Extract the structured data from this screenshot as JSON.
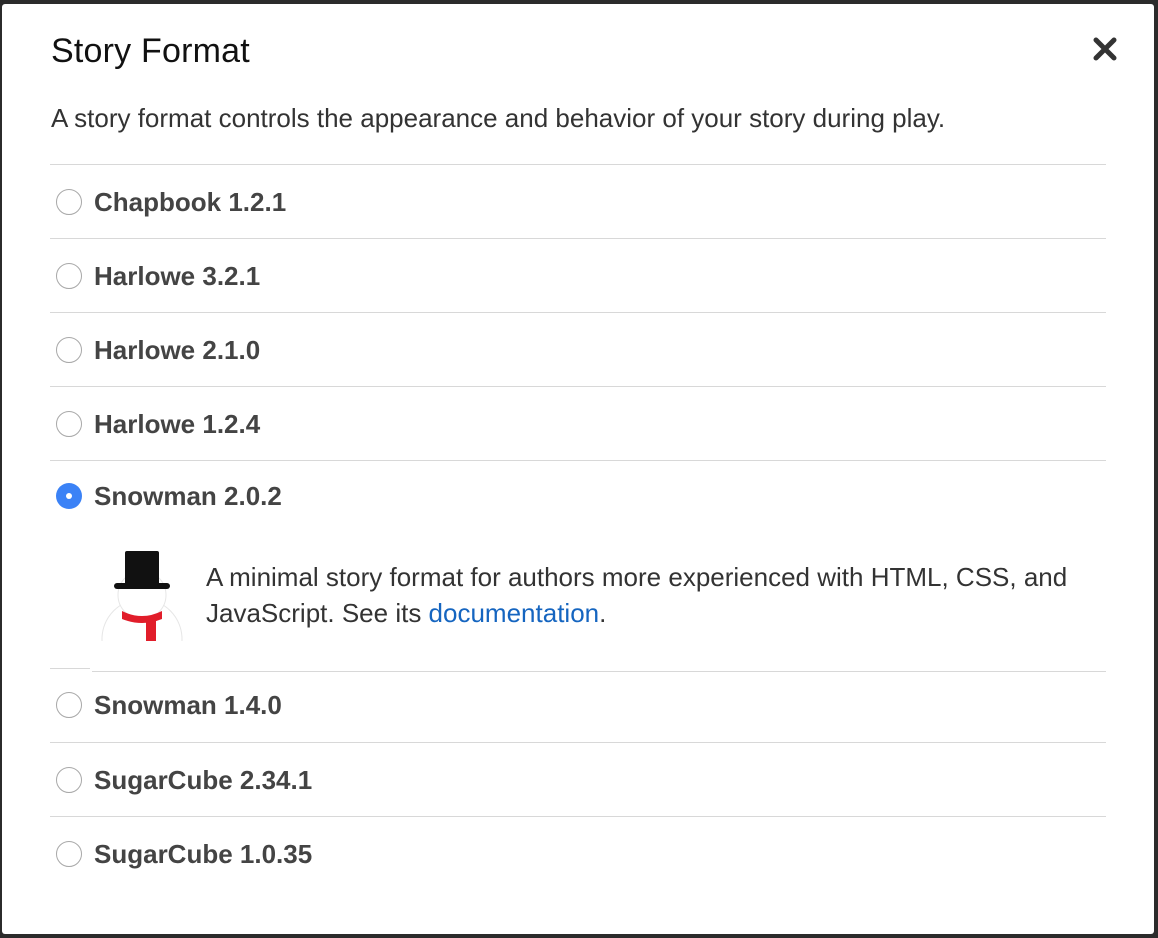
{
  "dialog": {
    "title": "Story Format",
    "close_icon": "close-icon",
    "intro": "A story format controls the appearance and behavior of your story during play."
  },
  "formats": [
    {
      "label": "Chapbook 1.2.1",
      "selected": false
    },
    {
      "label": "Harlowe 3.2.1",
      "selected": false
    },
    {
      "label": "Harlowe 2.1.0",
      "selected": false
    },
    {
      "label": "Harlowe 1.2.4",
      "selected": false
    },
    {
      "label": "Snowman 2.0.2",
      "selected": true
    },
    {
      "label": "Snowman 1.4.0",
      "selected": false
    },
    {
      "label": "SugarCube 2.34.1",
      "selected": false
    },
    {
      "label": "SugarCube 1.0.35",
      "selected": false
    }
  ],
  "selected_details": {
    "icon": "snowman-icon",
    "description_prefix": "A minimal story format for authors more experienced with HTML, CSS, and JavaScript. See its ",
    "link_text": "documentation",
    "description_suffix": "."
  },
  "colors": {
    "accent": "#3b82f6",
    "link": "#1565c0",
    "scarf": "#e11d2a"
  }
}
